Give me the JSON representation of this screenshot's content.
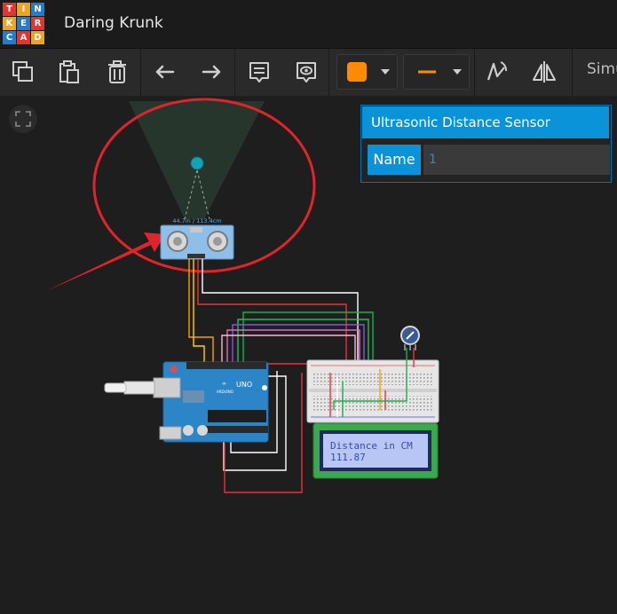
{
  "app": {
    "logo_letters": [
      "T",
      "I",
      "N",
      "K",
      "E",
      "R",
      "C",
      "A",
      "D"
    ],
    "logo_colors": [
      "#e8322b",
      "#f0a31b",
      "#1e7ed2",
      "#f0a31b",
      "#1e7ed2",
      "#e8322b",
      "#1e7ed2",
      "#e8322b",
      "#f0a31b"
    ],
    "project_title": "Daring Krunk"
  },
  "toolbar": {
    "tools": [
      {
        "name": "copy-icon"
      },
      {
        "name": "paste-icon"
      },
      {
        "name": "delete-icon"
      },
      {
        "name": "undo-icon"
      },
      {
        "name": "redo-icon"
      },
      {
        "name": "notes-icon"
      },
      {
        "name": "visibility-icon"
      },
      {
        "name": "wire-color-dropdown"
      },
      {
        "name": "wire-type-dropdown"
      },
      {
        "name": "rotate-icon"
      },
      {
        "name": "flip-icon"
      }
    ],
    "wire_color": "#ff8c00",
    "simulate_label": "Simu"
  },
  "inspector": {
    "title": "Ultrasonic Distance Sensor",
    "name_label": "Name",
    "name_value": "1"
  },
  "sensor": {
    "readout": "44.7in / 113.4cm"
  },
  "lcd": {
    "line1": "Distance in CM",
    "line2": "111.87"
  },
  "arduino": {
    "model": "UNO",
    "brand": "ARDUINO"
  },
  "colors": {
    "highlight": "#e0242a",
    "accent": "#0a93d8",
    "arduino_board": "#2c85c7",
    "lcd_screen": "#b7c6f4"
  }
}
